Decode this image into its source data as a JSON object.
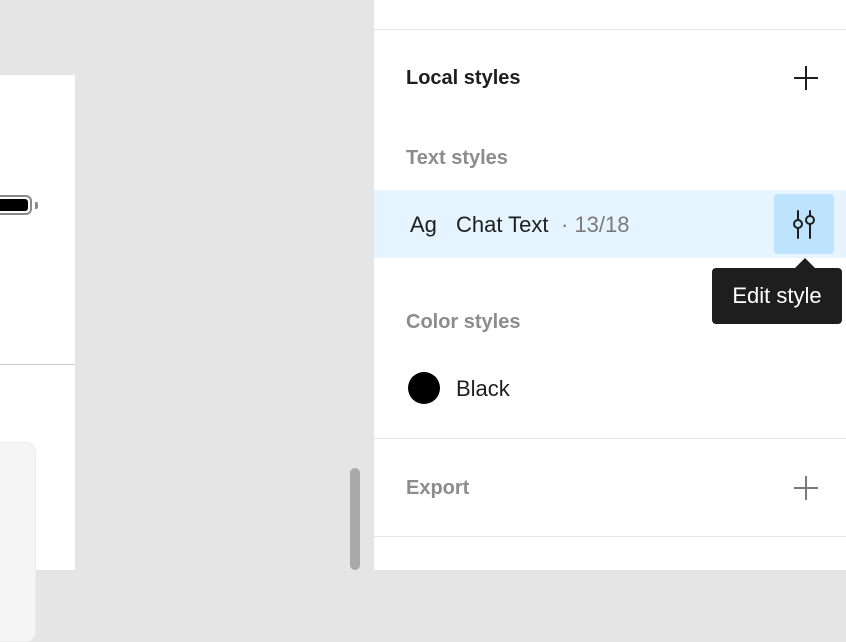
{
  "panel": {
    "local_styles": {
      "title": "Local styles",
      "add_icon": "plus-icon"
    },
    "text_styles": {
      "title": "Text styles",
      "items": [
        {
          "preview": "Ag",
          "name": "Chat Text",
          "meta": "· 13/18",
          "action_icon": "adjust-sliders-icon"
        }
      ]
    },
    "tooltip": {
      "label": "Edit style"
    },
    "color_styles": {
      "title": "Color styles",
      "items": [
        {
          "name": "Black",
          "color": "#000000"
        }
      ]
    },
    "export": {
      "title": "Export",
      "add_icon": "plus-icon"
    }
  },
  "colors": {
    "selected_row": "#e5f4ff",
    "action_button": "#bde3ff",
    "tooltip_bg": "#1e1e1e",
    "canvas_bg": "#e5e5e5"
  }
}
